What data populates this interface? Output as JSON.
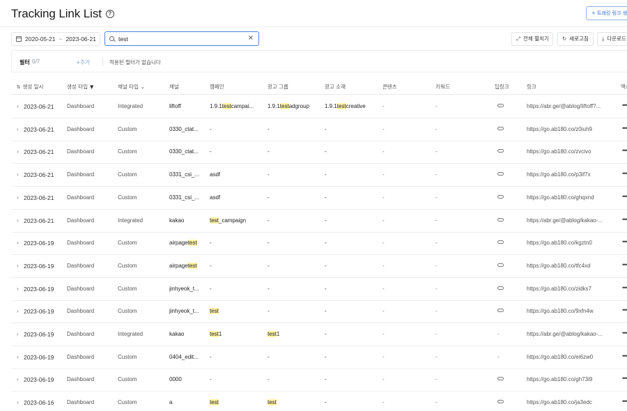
{
  "header": {
    "title": "Tracking Link List",
    "create_button": "+ 트래킹 링크 생성"
  },
  "toolbar": {
    "date_start": "2020-05-21",
    "date_sep": "~",
    "date_end": "2023-06-21",
    "search_value": "test",
    "expand_all": "전체 펼치기",
    "refresh": "새로고침",
    "download": "다운로드"
  },
  "filter": {
    "label": "필터",
    "count": "0/7",
    "add": "+추가",
    "empty": "적용된 필터가 없습니다"
  },
  "columns": {
    "date": "생성 일시",
    "gen_type": "생성 타입",
    "channel_type": "채널 타입",
    "channel": "채널",
    "campaign": "캠페인",
    "adgroup": "광고 그룹",
    "creative": "광고 소재",
    "content": "콘텐츠",
    "keyword": "키워드",
    "deeplink": "딥링크",
    "link": "링크",
    "action": "액션"
  },
  "rows": [
    {
      "date": "2023-06-21",
      "gen": "Dashboard",
      "chtype": "Integrated",
      "channel": [
        "liftoff",
        "",
        ""
      ],
      "campaign": [
        "1.9.1",
        "test",
        "campai..."
      ],
      "adgroup": [
        "1.9.1",
        "test",
        "adgroup"
      ],
      "creative": [
        "1.9.1",
        "test",
        "creative"
      ],
      "content": "-",
      "keyword": "-",
      "deeplink": "link",
      "link": "https://abr.ge/@ablog/liftoff?..."
    },
    {
      "date": "2023-06-21",
      "gen": "Dashboard",
      "chtype": "Custom",
      "channel": [
        "0330_ctat...",
        "",
        ""
      ],
      "campaign": [
        "-",
        "",
        ""
      ],
      "adgroup": [
        "-",
        "",
        ""
      ],
      "creative": [
        "-",
        "",
        ""
      ],
      "content": "-",
      "keyword": "-",
      "deeplink": "link",
      "link": "https://go.ab180.co/z0iuh9"
    },
    {
      "date": "2023-06-21",
      "gen": "Dashboard",
      "chtype": "Custom",
      "channel": [
        "0330_ctat...",
        "",
        ""
      ],
      "campaign": [
        "-",
        "",
        ""
      ],
      "adgroup": [
        "-",
        "",
        ""
      ],
      "creative": [
        "-",
        "",
        ""
      ],
      "content": "-",
      "keyword": "-",
      "deeplink": "link",
      "link": "https://go.ab180.co/zvcivo"
    },
    {
      "date": "2023-06-21",
      "gen": "Dashboard",
      "chtype": "Custom",
      "channel": [
        "0331_csi_...",
        "",
        ""
      ],
      "campaign": [
        "asdf",
        "",
        ""
      ],
      "adgroup": [
        "-",
        "",
        ""
      ],
      "creative": [
        "-",
        "",
        ""
      ],
      "content": "-",
      "keyword": "-",
      "deeplink": "link",
      "link": "https://go.ab180.co/p3if7x"
    },
    {
      "date": "2023-06-21",
      "gen": "Dashboard",
      "chtype": "Custom",
      "channel": [
        "0331_csi_...",
        "",
        ""
      ],
      "campaign": [
        "asdf",
        "",
        ""
      ],
      "adgroup": [
        "-",
        "",
        ""
      ],
      "creative": [
        "-",
        "",
        ""
      ],
      "content": "-",
      "keyword": "-",
      "deeplink": "link",
      "link": "https://go.ab180.co/ghqxnd"
    },
    {
      "date": "2023-06-21",
      "gen": "Dashboard",
      "chtype": "Integrated",
      "channel": [
        "kakao",
        "",
        ""
      ],
      "campaign": [
        "",
        "test",
        "_campaign"
      ],
      "adgroup": [
        "-",
        "",
        ""
      ],
      "creative": [
        "-",
        "",
        ""
      ],
      "content": "-",
      "keyword": "-",
      "deeplink": "link",
      "link": "https://abr.ge/@ablog/kakao-..."
    },
    {
      "date": "2023-06-19",
      "gen": "Dashboard",
      "chtype": "Custom",
      "channel": [
        "airpage",
        "test",
        ""
      ],
      "campaign": [
        "-",
        "",
        ""
      ],
      "adgroup": [
        "-",
        "",
        ""
      ],
      "creative": [
        "-",
        "",
        ""
      ],
      "content": "-",
      "keyword": "-",
      "deeplink": "link",
      "link": "https://go.ab180.co/kgztn0"
    },
    {
      "date": "2023-06-19",
      "gen": "Dashboard",
      "chtype": "Custom",
      "channel": [
        "airpage",
        "test",
        ""
      ],
      "campaign": [
        "-",
        "",
        ""
      ],
      "adgroup": [
        "-",
        "",
        ""
      ],
      "creative": [
        "-",
        "",
        ""
      ],
      "content": "-",
      "keyword": "-",
      "deeplink": "link",
      "link": "https://go.ab180.co/tfc4xd"
    },
    {
      "date": "2023-06-19",
      "gen": "Dashboard",
      "chtype": "Custom",
      "channel": [
        "jinhyeok_t...",
        "",
        ""
      ],
      "campaign": [
        "-",
        "",
        ""
      ],
      "adgroup": [
        "-",
        "",
        ""
      ],
      "creative": [
        "-",
        "",
        ""
      ],
      "content": "-",
      "keyword": "-",
      "deeplink": "link",
      "link": "https://go.ab180.co/zidks7"
    },
    {
      "date": "2023-06-19",
      "gen": "Dashboard",
      "chtype": "Custom",
      "channel": [
        "jinhyeok_t...",
        "",
        ""
      ],
      "campaign": [
        "",
        "test",
        ""
      ],
      "adgroup": [
        "-",
        "",
        ""
      ],
      "creative": [
        "-",
        "",
        ""
      ],
      "content": "-",
      "keyword": "-",
      "deeplink": "link",
      "link": "https://go.ab180.co/9xfn4w"
    },
    {
      "date": "2023-06-19",
      "gen": "Dashboard",
      "chtype": "Integrated",
      "channel": [
        "kakao",
        "",
        ""
      ],
      "campaign": [
        "",
        "test",
        "1"
      ],
      "adgroup": [
        "",
        "test",
        "1"
      ],
      "creative": [
        "-",
        "",
        ""
      ],
      "content": "-",
      "keyword": "-",
      "deeplink": "-",
      "link": "https://abr.ge/@ablog/kakao-..."
    },
    {
      "date": "2023-06-19",
      "gen": "Dashboard",
      "chtype": "Custom",
      "channel": [
        "0404_edit...",
        "",
        ""
      ],
      "campaign": [
        "-",
        "",
        ""
      ],
      "adgroup": [
        "-",
        "",
        ""
      ],
      "creative": [
        "-",
        "",
        ""
      ],
      "content": "-",
      "keyword": "-",
      "deeplink": "-",
      "link": "https://go.ab180.co/ei6zw0"
    },
    {
      "date": "2023-06-19",
      "gen": "Dashboard",
      "chtype": "Custom",
      "channel": [
        "0000",
        "",
        ""
      ],
      "campaign": [
        "-",
        "",
        ""
      ],
      "adgroup": [
        "-",
        "",
        ""
      ],
      "creative": [
        "-",
        "",
        ""
      ],
      "content": "-",
      "keyword": "-",
      "deeplink": "link",
      "link": "https://go.ab180.co/gh73i9"
    },
    {
      "date": "2023-06-16",
      "gen": "Dashboard",
      "chtype": "Custom",
      "channel": [
        "a",
        "",
        ""
      ],
      "campaign": [
        "",
        "test",
        ""
      ],
      "adgroup": [
        "",
        "test",
        ""
      ],
      "creative": [
        "-",
        "",
        ""
      ],
      "content": "-",
      "keyword": "-",
      "deeplink": "link",
      "link": "https://go.ab180.co/ja3edc"
    }
  ]
}
